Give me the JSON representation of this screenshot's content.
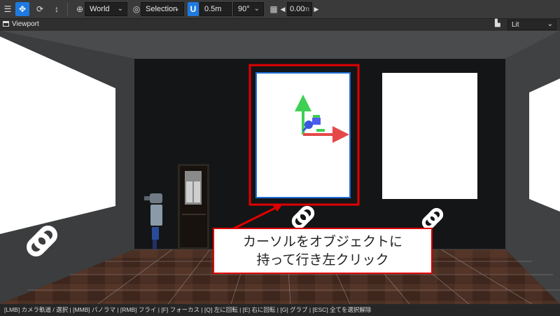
{
  "toolbar": {
    "space_select": "World",
    "mode_select": "Selection",
    "snap_value": "0.5m",
    "angle_select": "90°",
    "grid_value": "0.00",
    "grid_unit": "m"
  },
  "viewport": {
    "title": "Viewport",
    "shading_select": "Lit"
  },
  "callout": {
    "line1": "カーソルをオブジェクトに",
    "line2": "持って行き左クリック",
    "color": "#e00000"
  },
  "status_bar": {
    "text": "[LMB] カメラ軌道 / 選択 | [MMB] パノラマ | [RMB] フライ | [F] フォーカス | [Q] 左に回転 | [E] 右に回転 | [G] グラブ | [ESC] 全てを選択解除"
  },
  "colors": {
    "accent": "#1f7ae0",
    "highlight": "#e00000"
  }
}
